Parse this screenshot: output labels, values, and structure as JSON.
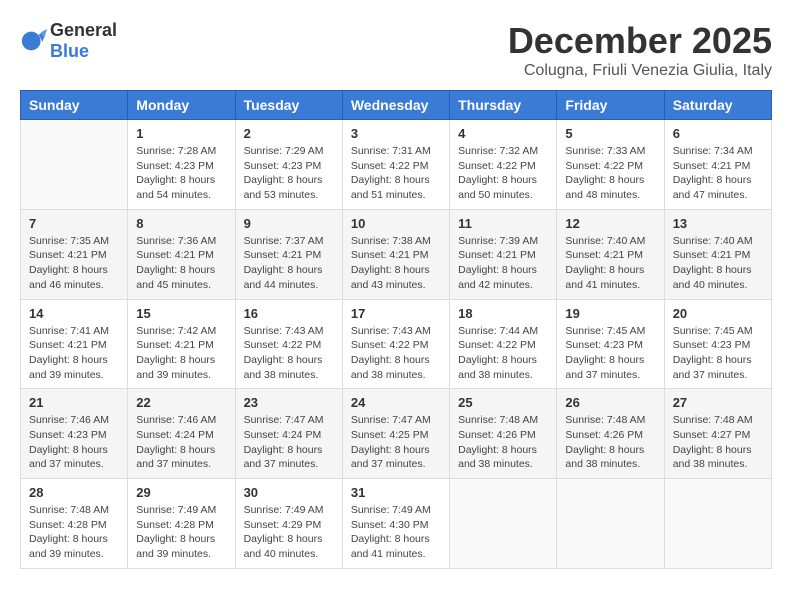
{
  "header": {
    "logo_general": "General",
    "logo_blue": "Blue",
    "month_title": "December 2025",
    "location": "Colugna, Friuli Venezia Giulia, Italy"
  },
  "weekdays": [
    "Sunday",
    "Monday",
    "Tuesday",
    "Wednesday",
    "Thursday",
    "Friday",
    "Saturday"
  ],
  "weeks": [
    [
      {
        "day": "",
        "info": ""
      },
      {
        "day": "1",
        "info": "Sunrise: 7:28 AM\nSunset: 4:23 PM\nDaylight: 8 hours\nand 54 minutes."
      },
      {
        "day": "2",
        "info": "Sunrise: 7:29 AM\nSunset: 4:23 PM\nDaylight: 8 hours\nand 53 minutes."
      },
      {
        "day": "3",
        "info": "Sunrise: 7:31 AM\nSunset: 4:22 PM\nDaylight: 8 hours\nand 51 minutes."
      },
      {
        "day": "4",
        "info": "Sunrise: 7:32 AM\nSunset: 4:22 PM\nDaylight: 8 hours\nand 50 minutes."
      },
      {
        "day": "5",
        "info": "Sunrise: 7:33 AM\nSunset: 4:22 PM\nDaylight: 8 hours\nand 48 minutes."
      },
      {
        "day": "6",
        "info": "Sunrise: 7:34 AM\nSunset: 4:21 PM\nDaylight: 8 hours\nand 47 minutes."
      }
    ],
    [
      {
        "day": "7",
        "info": "Sunrise: 7:35 AM\nSunset: 4:21 PM\nDaylight: 8 hours\nand 46 minutes."
      },
      {
        "day": "8",
        "info": "Sunrise: 7:36 AM\nSunset: 4:21 PM\nDaylight: 8 hours\nand 45 minutes."
      },
      {
        "day": "9",
        "info": "Sunrise: 7:37 AM\nSunset: 4:21 PM\nDaylight: 8 hours\nand 44 minutes."
      },
      {
        "day": "10",
        "info": "Sunrise: 7:38 AM\nSunset: 4:21 PM\nDaylight: 8 hours\nand 43 minutes."
      },
      {
        "day": "11",
        "info": "Sunrise: 7:39 AM\nSunset: 4:21 PM\nDaylight: 8 hours\nand 42 minutes."
      },
      {
        "day": "12",
        "info": "Sunrise: 7:40 AM\nSunset: 4:21 PM\nDaylight: 8 hours\nand 41 minutes."
      },
      {
        "day": "13",
        "info": "Sunrise: 7:40 AM\nSunset: 4:21 PM\nDaylight: 8 hours\nand 40 minutes."
      }
    ],
    [
      {
        "day": "14",
        "info": "Sunrise: 7:41 AM\nSunset: 4:21 PM\nDaylight: 8 hours\nand 39 minutes."
      },
      {
        "day": "15",
        "info": "Sunrise: 7:42 AM\nSunset: 4:21 PM\nDaylight: 8 hours\nand 39 minutes."
      },
      {
        "day": "16",
        "info": "Sunrise: 7:43 AM\nSunset: 4:22 PM\nDaylight: 8 hours\nand 38 minutes."
      },
      {
        "day": "17",
        "info": "Sunrise: 7:43 AM\nSunset: 4:22 PM\nDaylight: 8 hours\nand 38 minutes."
      },
      {
        "day": "18",
        "info": "Sunrise: 7:44 AM\nSunset: 4:22 PM\nDaylight: 8 hours\nand 38 minutes."
      },
      {
        "day": "19",
        "info": "Sunrise: 7:45 AM\nSunset: 4:23 PM\nDaylight: 8 hours\nand 37 minutes."
      },
      {
        "day": "20",
        "info": "Sunrise: 7:45 AM\nSunset: 4:23 PM\nDaylight: 8 hours\nand 37 minutes."
      }
    ],
    [
      {
        "day": "21",
        "info": "Sunrise: 7:46 AM\nSunset: 4:23 PM\nDaylight: 8 hours\nand 37 minutes."
      },
      {
        "day": "22",
        "info": "Sunrise: 7:46 AM\nSunset: 4:24 PM\nDaylight: 8 hours\nand 37 minutes."
      },
      {
        "day": "23",
        "info": "Sunrise: 7:47 AM\nSunset: 4:24 PM\nDaylight: 8 hours\nand 37 minutes."
      },
      {
        "day": "24",
        "info": "Sunrise: 7:47 AM\nSunset: 4:25 PM\nDaylight: 8 hours\nand 37 minutes."
      },
      {
        "day": "25",
        "info": "Sunrise: 7:48 AM\nSunset: 4:26 PM\nDaylight: 8 hours\nand 38 minutes."
      },
      {
        "day": "26",
        "info": "Sunrise: 7:48 AM\nSunset: 4:26 PM\nDaylight: 8 hours\nand 38 minutes."
      },
      {
        "day": "27",
        "info": "Sunrise: 7:48 AM\nSunset: 4:27 PM\nDaylight: 8 hours\nand 38 minutes."
      }
    ],
    [
      {
        "day": "28",
        "info": "Sunrise: 7:48 AM\nSunset: 4:28 PM\nDaylight: 8 hours\nand 39 minutes."
      },
      {
        "day": "29",
        "info": "Sunrise: 7:49 AM\nSunset: 4:28 PM\nDaylight: 8 hours\nand 39 minutes."
      },
      {
        "day": "30",
        "info": "Sunrise: 7:49 AM\nSunset: 4:29 PM\nDaylight: 8 hours\nand 40 minutes."
      },
      {
        "day": "31",
        "info": "Sunrise: 7:49 AM\nSunset: 4:30 PM\nDaylight: 8 hours\nand 41 minutes."
      },
      {
        "day": "",
        "info": ""
      },
      {
        "day": "",
        "info": ""
      },
      {
        "day": "",
        "info": ""
      }
    ]
  ]
}
